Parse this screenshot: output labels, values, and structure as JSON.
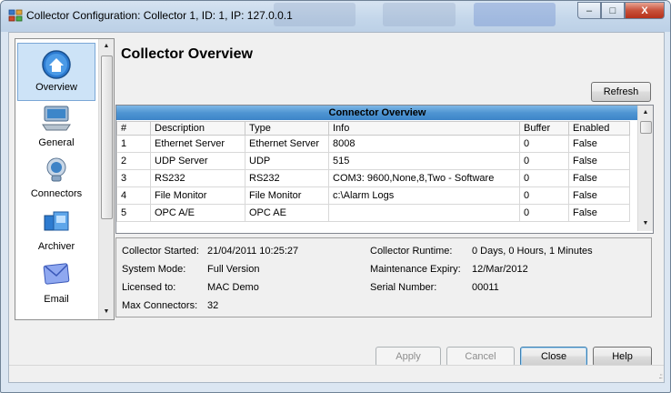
{
  "window": {
    "title": "Collector Configuration: Collector 1, ID: 1, IP: 127.0.0.1",
    "minimize_label": "–",
    "maximize_label": "□",
    "close_label": "X"
  },
  "sidebar": {
    "items": [
      {
        "label": "Overview",
        "icon": "home-icon",
        "selected": true
      },
      {
        "label": "General",
        "icon": "computer-icon",
        "selected": false
      },
      {
        "label": "Connectors",
        "icon": "connector-icon",
        "selected": false
      },
      {
        "label": "Archiver",
        "icon": "archiver-icon",
        "selected": false
      },
      {
        "label": "Email",
        "icon": "email-icon",
        "selected": false
      }
    ]
  },
  "main": {
    "title": "Collector Overview",
    "refresh_label": "Refresh"
  },
  "grid": {
    "title": "Connector Overview",
    "columns": [
      "#",
      "Description",
      "Type",
      "Info",
      "Buffer",
      "Enabled"
    ],
    "rows": [
      [
        "1",
        "Ethernet Server",
        "Ethernet Server",
        "8008",
        "0",
        "False"
      ],
      [
        "2",
        "UDP Server",
        "UDP",
        "515",
        "0",
        "False"
      ],
      [
        "3",
        "RS232",
        "RS232",
        "COM3: 9600,None,8,Two - Software",
        "0",
        "False"
      ],
      [
        "4",
        "File Monitor",
        "File Monitor",
        "c:\\Alarm Logs",
        "0",
        "False"
      ],
      [
        "5",
        "OPC A/E",
        "OPC AE",
        "",
        "0",
        "False"
      ]
    ]
  },
  "info": {
    "collector_started_label": "Collector Started:",
    "collector_started_value": "21/04/2011 10:25:27",
    "system_mode_label": "System Mode:",
    "system_mode_value": "Full Version",
    "licensed_to_label": "Licensed to:",
    "licensed_to_value": "MAC Demo",
    "max_connectors_label": "Max Connectors:",
    "max_connectors_value": "32",
    "runtime_label": "Collector Runtime:",
    "runtime_value": "0 Days, 0 Hours, 1 Minutes",
    "maintenance_label": "Maintenance Expiry:",
    "maintenance_value": "12/Mar/2012",
    "serial_label": "Serial Number:",
    "serial_value": "00011"
  },
  "buttons": {
    "apply": "Apply",
    "cancel": "Cancel",
    "close": "Close",
    "help": "Help"
  },
  "colors": {
    "grid_header": "#4f95d2",
    "selection": "#cde3f7"
  }
}
